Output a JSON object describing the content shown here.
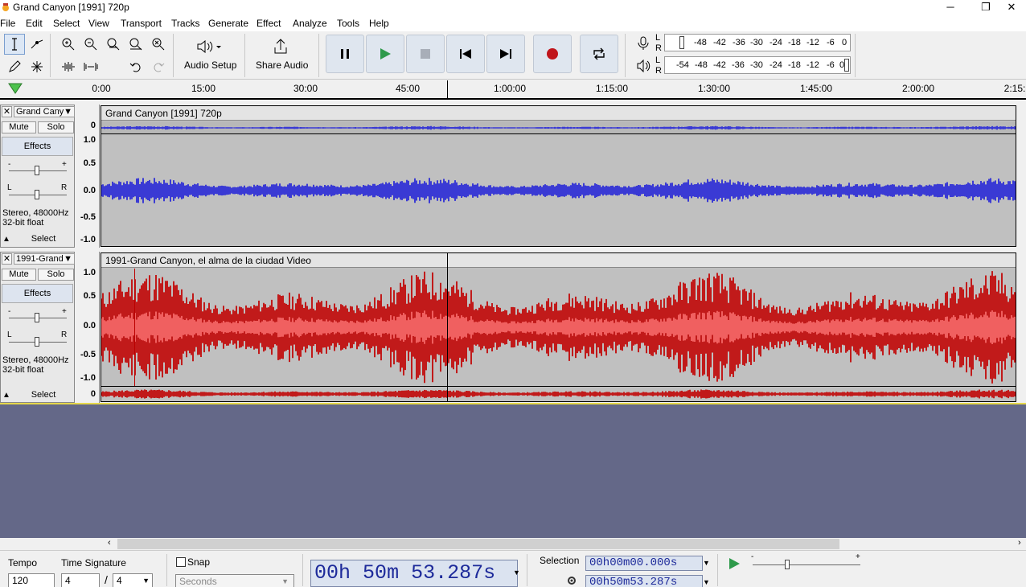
{
  "window": {
    "title": "Grand Canyon [1991] 720p",
    "minimize": "─",
    "maximize": "❐",
    "close": "✕"
  },
  "menu": [
    "File",
    "Edit",
    "Select",
    "View",
    "Transport",
    "Tracks",
    "Generate",
    "Effect",
    "Analyze",
    "Tools",
    "Help"
  ],
  "toolbar": {
    "audio_setup_label": "Audio Setup",
    "share_audio_label": "Share Audio",
    "record_meter_ticks": [
      "-48",
      "-42",
      "-36",
      "-30",
      "-24",
      "-18",
      "-12",
      "-6",
      "0"
    ],
    "playback_meter_ticks": [
      "-54",
      "-48",
      "-42",
      "-36",
      "-30",
      "-24",
      "-18",
      "-12",
      "-6",
      "0"
    ],
    "meter_channels": [
      "L",
      "R"
    ]
  },
  "ruler": {
    "labels": [
      "0:00",
      "15:00",
      "30:00",
      "45:00",
      "1:00:00",
      "1:15:00",
      "1:30:00",
      "1:45:00",
      "2:00:00",
      "2:15:"
    ]
  },
  "tracks": [
    {
      "name": "Grand Cany",
      "clip_title": "Grand Canyon [1991] 720p",
      "mute": "Mute",
      "solo": "Solo",
      "effects": "Effects",
      "info1": "Stereo, 48000Hz",
      "info2": "32-bit float",
      "select": "Select",
      "scale": [
        "1.0",
        "0.5",
        "0.0",
        "-0.5",
        "-1.0"
      ],
      "collapsed_value": "0",
      "color": "#3a3ad4"
    },
    {
      "name": "1991-Grand",
      "clip_title": "1991-Grand Canyon, el alma de la ciudad Video",
      "mute": "Mute",
      "solo": "Solo",
      "effects": "Effects",
      "info1": "Stereo, 48000Hz",
      "info2": "32-bit float",
      "select": "Select",
      "scale": [
        "1.0",
        "0.5",
        "0.0",
        "-0.5",
        "-1.0"
      ],
      "collapsed_value": "0",
      "color": "#c11a1a"
    }
  ],
  "gain_slider": {
    "minus": "-",
    "plus": "+"
  },
  "pan_slider": {
    "left": "L",
    "right": "R"
  },
  "bottom": {
    "tempo_label": "Tempo",
    "tempo_value": "120",
    "time_signature_label": "Time Signature",
    "time_sig_top": "4",
    "time_sig_slash": "/",
    "time_sig_bottom": "4",
    "snap_label": "Snap",
    "snap_unit": "Seconds",
    "time_display": {
      "hh": "00",
      "h": "h",
      "mm": "50",
      "m": "m",
      "ss": "53.287",
      "s": "s"
    },
    "selection_label": "Selection",
    "selection_start": "00h00m00.000s",
    "selection_end": "00h50m53.287s",
    "speed_minus": "-",
    "speed_plus": "+"
  }
}
